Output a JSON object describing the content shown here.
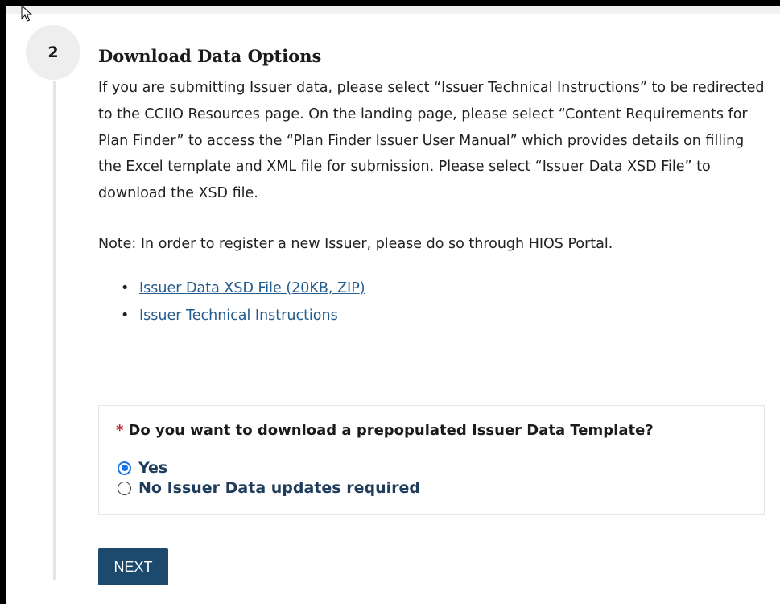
{
  "step": {
    "number": "2",
    "title": "Download Data Options"
  },
  "body": {
    "paragraph": "If you are submitting Issuer data, please select “Issuer Technical Instructions” to be redirected to the CCIIO Resources page. On the landing page, please select “Content Requirements for Plan Finder” to access the “Plan Finder Issuer User Manual” which provides details on filling the Excel template and XML file for submission. Please select “Issuer Data XSD File” to download the XSD file.",
    "note": "Note: In order to register a new Issuer, please do so through HIOS Portal."
  },
  "links": [
    {
      "label": "Issuer Data XSD File (20KB, ZIP)"
    },
    {
      "label": "Issuer Technical Instructions"
    }
  ],
  "question": {
    "required_marker": "*",
    "label": "Do you want to download a prepopulated Issuer Data Template?",
    "options": [
      {
        "label": "Yes",
        "selected": true
      },
      {
        "label": "No Issuer Data updates required",
        "selected": false
      }
    ]
  },
  "actions": {
    "next_label": "NEXT"
  },
  "colors": {
    "link": "#245c8d",
    "button": "#1c4a6e",
    "required": "#c0272d",
    "radio_selected": "#1a73e8"
  }
}
